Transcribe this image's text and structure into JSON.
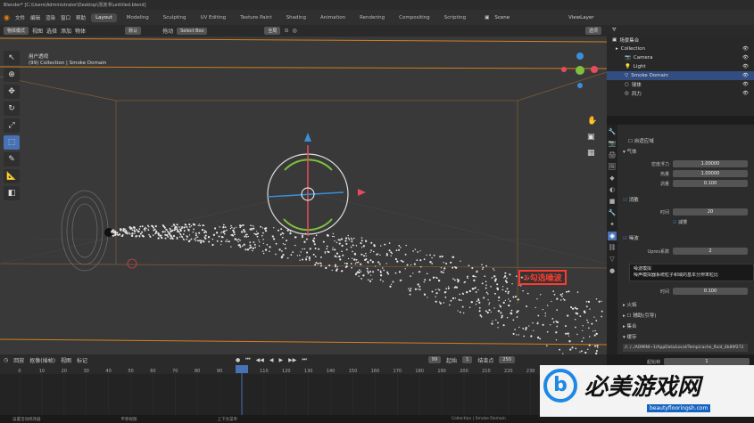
{
  "window": {
    "title": "Blender* [C:\\Users\\Administrator\\Desktop\\漂流书\\untitled.blend]"
  },
  "menu": {
    "items": [
      "文件",
      "编辑",
      "渲染",
      "窗口",
      "帮助"
    ]
  },
  "workspaces": [
    "Layout",
    "Modeling",
    "Sculpting",
    "UV Editing",
    "Texture Paint",
    "Shading",
    "Animation",
    "Rendering",
    "Compositing",
    "Scripting"
  ],
  "scene": "Scene",
  "view_layer": "ViewLayer",
  "viewport_header": {
    "mode": "物体模式",
    "view": "视图",
    "select": "选择",
    "add": "添加",
    "object": "物体",
    "orientation": "全局",
    "transform": "默认",
    "drag": "拖动",
    "select_box": "Select Box",
    "options": "选项"
  },
  "viewport": {
    "view_label": "用户透视",
    "collection_label": "(99) Collection | Smoke Domain"
  },
  "outliner": {
    "root": "场景集合",
    "items": [
      {
        "name": "Collection",
        "indent": 0
      },
      {
        "name": "Camera",
        "indent": 1
      },
      {
        "name": "Light",
        "indent": 1
      },
      {
        "name": "Smoke Domain",
        "indent": 1,
        "selected": true
      },
      {
        "name": "球体",
        "indent": 1
      },
      {
        "name": "风力",
        "indent": 1
      }
    ]
  },
  "properties": {
    "section_a": "自适应域",
    "section_b": "气体",
    "rows_b": [
      {
        "label": "密度浮力",
        "value": "1.00000"
      },
      {
        "label": "热量",
        "value": "1.00000"
      },
      {
        "label": "涡量",
        "value": "0.100"
      }
    ],
    "dissolve": "消散",
    "time_label": "时间",
    "time_value": "20",
    "slow_label": "减慢",
    "noise": "噪波",
    "upres_label": "Upres系数",
    "upres_value": "2",
    "time2_label": "时间",
    "time2_value": "0.100",
    "fire": "火焰",
    "guides": "辅助(引导)",
    "collections": "集合",
    "cache": "缓存",
    "cache_path": "//../../ADMINI~1/AppData/Local/Temp/cache_fluid_4b89f272",
    "frame_start_label": "起始帧",
    "frame_start_value": "1"
  },
  "tooltip": {
    "title": "噪波模拟",
    "body": "噪声模拟器系统粒子和域的基本分辨率粒比"
  },
  "annotation": "①勾选噪波",
  "timeline": {
    "menus": [
      "回放",
      "抠像(插帧)",
      "视图",
      "标记"
    ],
    "current_frame": "99",
    "start_label": "起始",
    "start_value": "1",
    "end_label": "结束点",
    "end_value": "250",
    "ticks": [
      "0",
      "10",
      "20",
      "30",
      "40",
      "50",
      "60",
      "70",
      "80",
      "90",
      "100",
      "110",
      "120",
      "130",
      "140",
      "150",
      "160",
      "170",
      "180",
      "190",
      "200",
      "210",
      "220",
      "230",
      "240",
      "250"
    ]
  },
  "statusbar": {
    "left": "设置活动修改器",
    "mid": "平移视图",
    "right": "上下文菜单",
    "info": "Collection | Smoke Domain"
  },
  "watermark": {
    "text": "必美游戏网",
    "url": "beautyflooringsh.com"
  }
}
